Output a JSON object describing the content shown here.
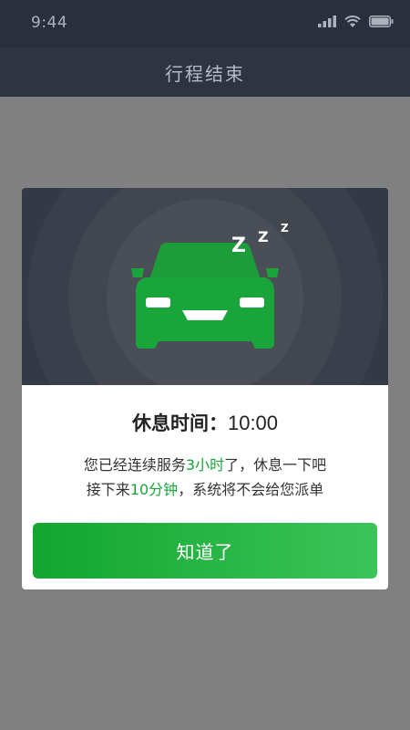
{
  "status_bar": {
    "time": "9:44",
    "icons": [
      "signal-icon",
      "wifi-icon",
      "battery-icon"
    ]
  },
  "nav": {
    "title": "行程结束"
  },
  "dialog": {
    "icon": "sleeping-car-icon",
    "sleep_text": "z z z",
    "rest_label": "休息时间：",
    "rest_time": "10:00",
    "message_line1": {
      "before": "您已经连续服务",
      "highlight": "3小时",
      "after": "了，休息一下吧"
    },
    "message_line2": {
      "before": "接下来",
      "highlight": "10分钟",
      "after": "，系统将不会给您派单"
    },
    "button_label": "知道了"
  },
  "colors": {
    "accent_green": "#1aa53a",
    "button_gradient_start": "#13a52f",
    "button_gradient_end": "#3cc45a",
    "header_bg": "#2f3443",
    "overlay": "#808080"
  }
}
